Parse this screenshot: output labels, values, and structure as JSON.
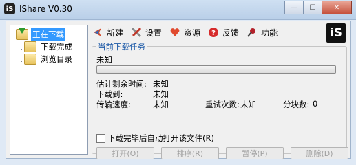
{
  "window": {
    "app_icon_text": "iS",
    "title": "IShare V0.30",
    "minimize": "—",
    "maximize": "☐",
    "close": "✕"
  },
  "tree": {
    "items": [
      {
        "label": "正在下载",
        "icon": "download-arrow-icon"
      },
      {
        "label": "下载完成",
        "icon": "folder-icon"
      },
      {
        "label": "浏览目录",
        "icon": "folder-icon"
      }
    ]
  },
  "toolbar": {
    "items": [
      {
        "label": "新建",
        "icon": "new-arrow-icon"
      },
      {
        "label": "设置",
        "icon": "tools-icon"
      },
      {
        "label": "资源",
        "icon": "heart-icon"
      },
      {
        "label": "反馈",
        "icon": "help-icon"
      },
      {
        "label": "功能",
        "icon": "pin-icon"
      }
    ],
    "logo": "iS"
  },
  "task": {
    "group_title": "当前下载任务",
    "file_name": "未知",
    "progress_fraction": 0,
    "remaining_label": "估计剩余时间:",
    "remaining_value": "未知",
    "downloaded_label": "下载到:",
    "downloaded_value": "未知",
    "speed_label": "传输速度:",
    "speed_value": "未知",
    "retries_label": "重试次数:",
    "retries_value": "未知",
    "blocks_label": "分块数:",
    "blocks_value": "0",
    "auto_open_label": "下载完毕后自动打开该文件(",
    "auto_open_key": "R",
    "auto_open_suffix": ")",
    "auto_open_checked": false
  },
  "buttons": {
    "open": "打开(O)",
    "sort": "排序(R)",
    "pause": "暂停(P)",
    "delete": "删除(D)"
  },
  "colors": {
    "accent_blue": "#3399ff",
    "group_title": "#1d5aa8"
  }
}
